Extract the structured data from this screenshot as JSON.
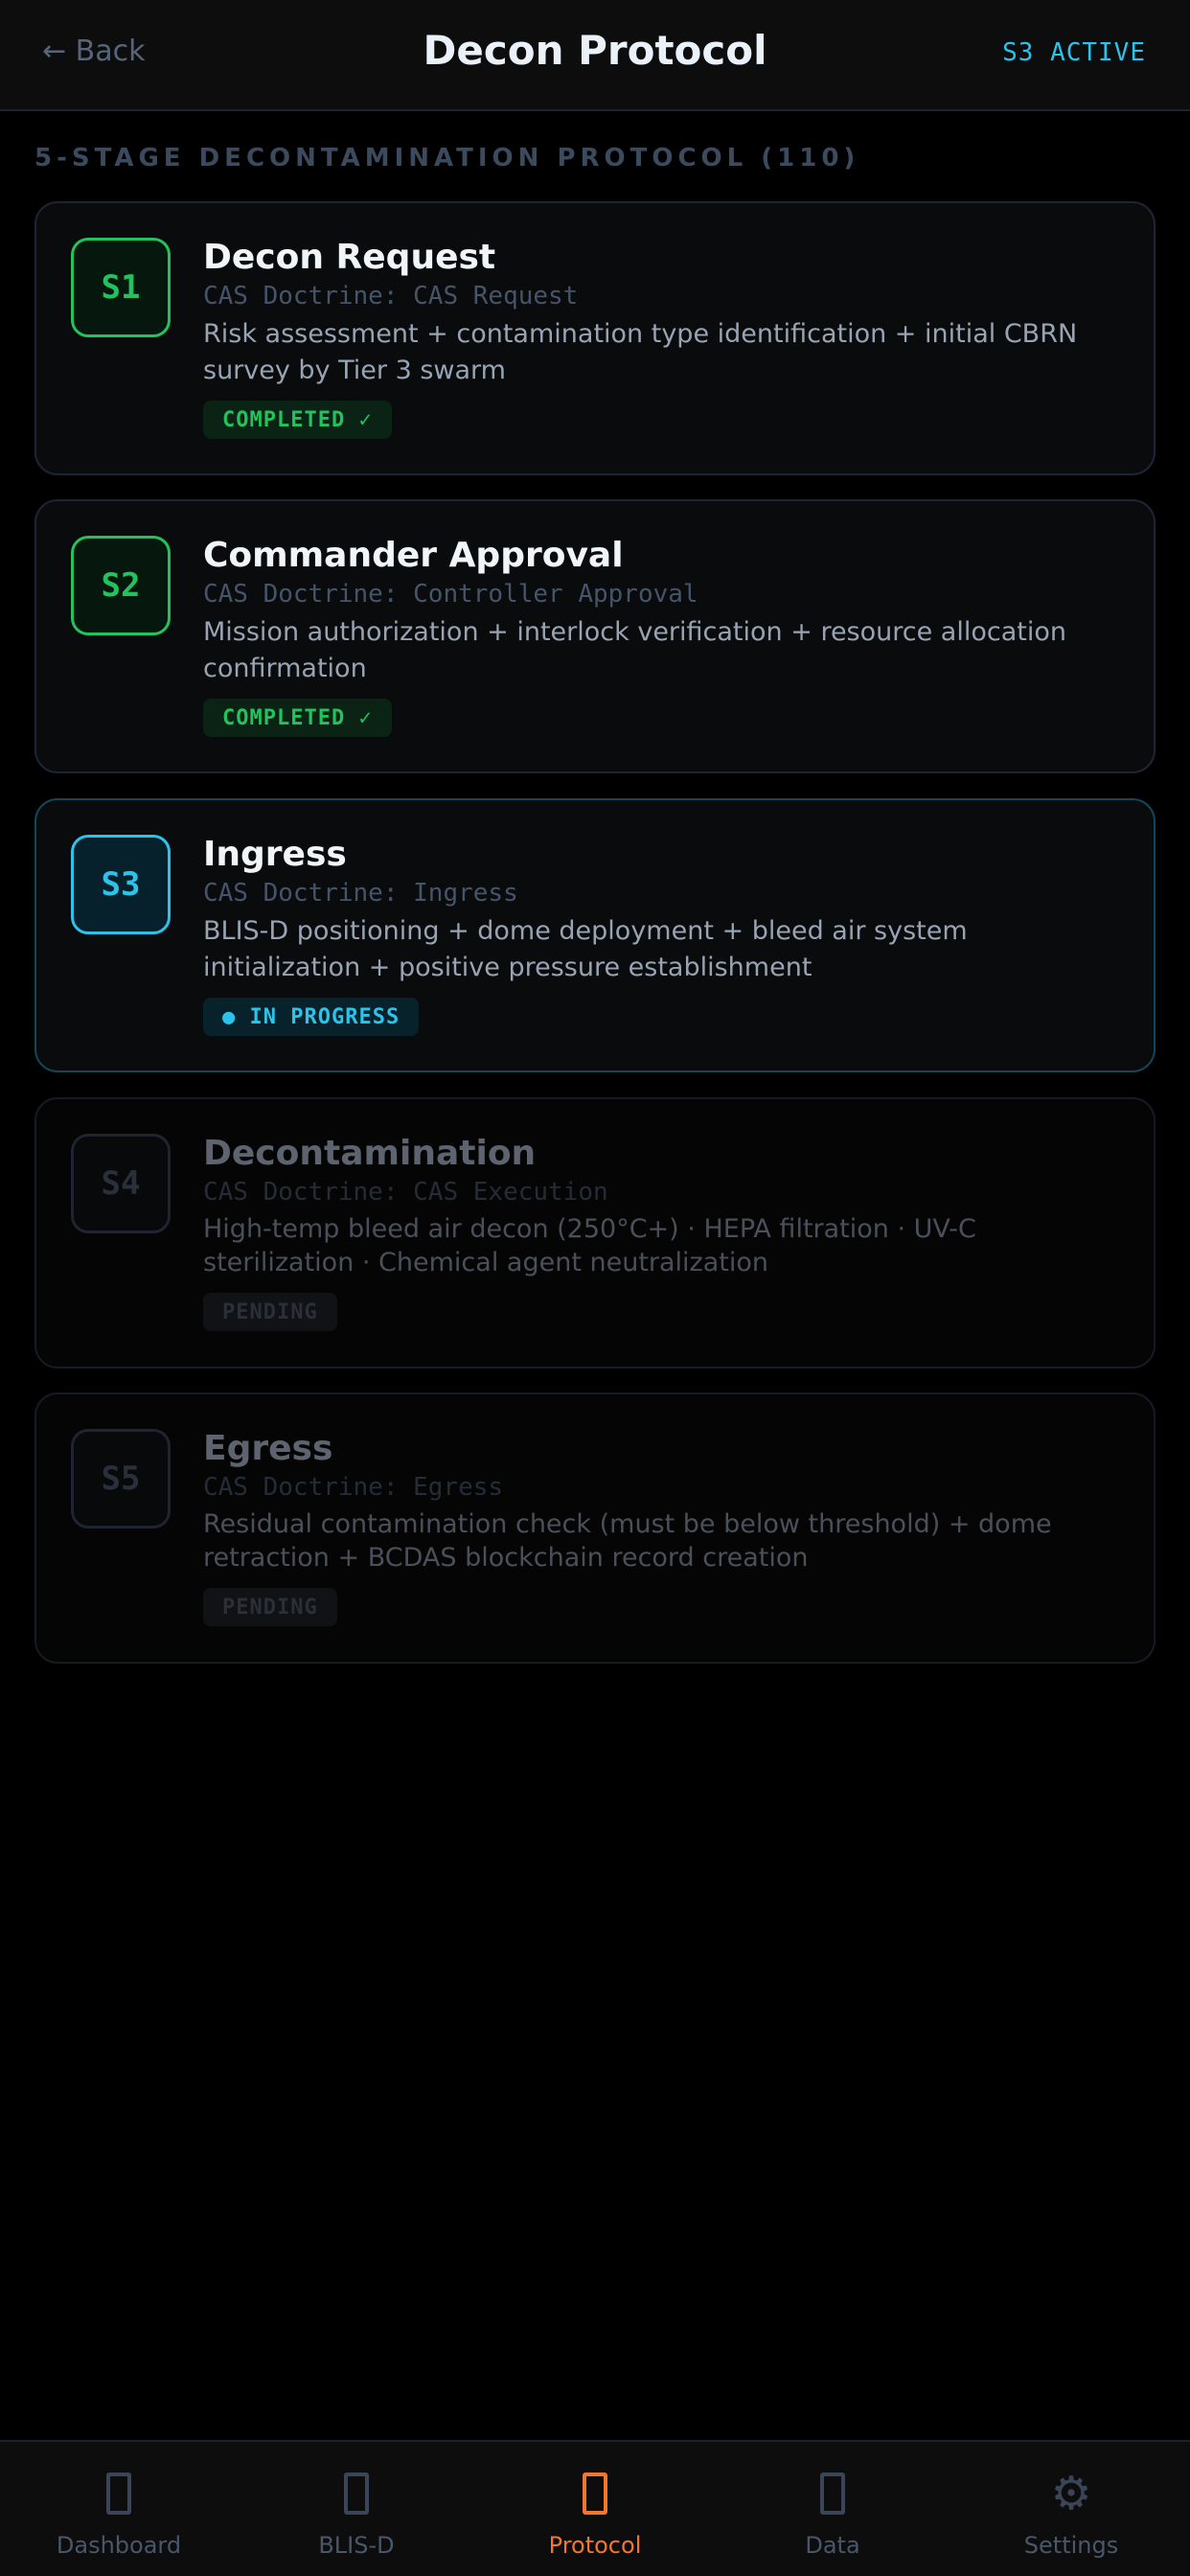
{
  "header": {
    "back_label": "← Back",
    "title": "Decon Protocol",
    "active_badge": "S3 ACTIVE"
  },
  "section_title": "5-STAGE DECONTAMINATION PROTOCOL (110)",
  "stages": [
    {
      "code": "S1",
      "title": "Decon Request",
      "doctrine": "CAS Doctrine: CAS Request",
      "description": "Risk assessment + contamination type identification + initial CBRN survey by Tier 3 swarm",
      "status": "COMPLETED ✓",
      "state": "completed"
    },
    {
      "code": "S2",
      "title": "Commander Approval",
      "doctrine": "CAS Doctrine: Controller Approval",
      "description": "Mission authorization + interlock verification + resource allocation confirmation",
      "status": "COMPLETED ✓",
      "state": "completed"
    },
    {
      "code": "S3",
      "title": "Ingress",
      "doctrine": "CAS Doctrine: Ingress",
      "description": "BLIS-D positioning + dome deployment + bleed air system initialization + positive pressure establishment",
      "status": "● IN PROGRESS",
      "state": "in-progress"
    },
    {
      "code": "S4",
      "title": "Decontamination",
      "doctrine": "CAS Doctrine: CAS Execution",
      "description": "High-temp bleed air decon (250°C+) · HEPA filtration · UV-C sterilization · Chemical agent neutralization",
      "status": "PENDING",
      "state": "pending"
    },
    {
      "code": "S5",
      "title": "Egress",
      "doctrine": "CAS Doctrine: Egress",
      "description": "Residual contamination check (must be below threshold) + dome retraction + BCDAS blockchain record creation",
      "status": "PENDING",
      "state": "pending"
    }
  ],
  "tabbar": {
    "items": [
      {
        "label": "Dashboard",
        "icon": "dashboard-icon",
        "active": false
      },
      {
        "label": "BLIS-D",
        "icon": "blis-d-icon",
        "active": false
      },
      {
        "label": "Protocol",
        "icon": "protocol-icon",
        "active": true
      },
      {
        "label": "Data",
        "icon": "data-icon",
        "active": false
      },
      {
        "label": "Settings",
        "icon": "gear-icon",
        "active": false
      }
    ]
  },
  "colors": {
    "completed": "#22c35e",
    "in_progress": "#2cc3ea",
    "active_tab": "#f2762e",
    "background": "#000000"
  }
}
